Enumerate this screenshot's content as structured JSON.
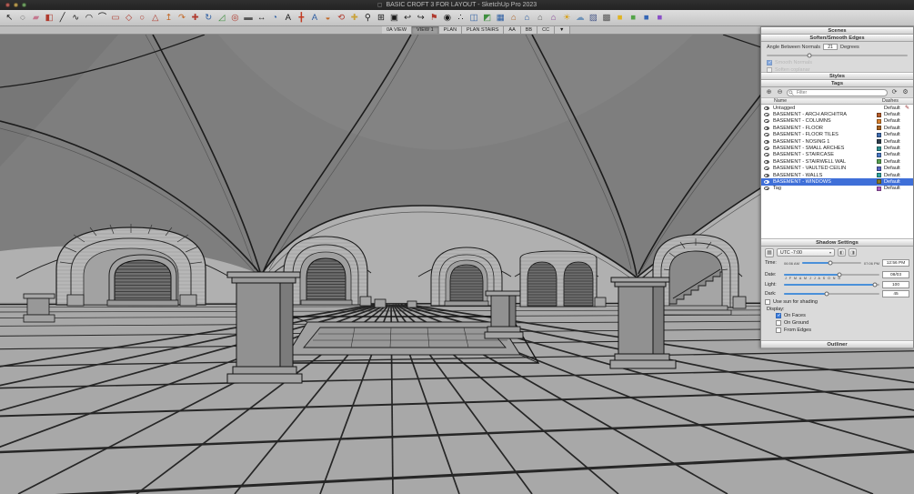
{
  "window": {
    "title": "BASIC CROFT 3 FOR LAYOUT - SketchUp Pro 2023"
  },
  "icons": {
    "add": "⊕",
    "remove": "⊖",
    "purge": "⟳",
    "gear": "⚙",
    "pencil": "✎",
    "dropdown_arrow": "▾",
    "document_proxy": "▢",
    "shadow_toggle": "▦",
    "detail_left": "◧",
    "detail_right": "◨"
  },
  "colors": {
    "selection": "#3f6fd8",
    "checkbox_accent": "#3d7fe0"
  },
  "toolbar": {
    "icons": [
      {
        "name": "select",
        "glyph": "↖",
        "color": "#1a1a1a"
      },
      {
        "name": "lasso",
        "glyph": "◌",
        "color": "#1a1a1a"
      },
      {
        "name": "eraser",
        "glyph": "▰",
        "color": "#c4788f"
      },
      {
        "name": "paint-bucket",
        "glyph": "◧",
        "color": "#b03a2e"
      },
      {
        "name": "line",
        "glyph": "╱",
        "color": "#1a1a1a"
      },
      {
        "name": "freehand",
        "glyph": "∿",
        "color": "#1a1a1a"
      },
      {
        "name": "arc",
        "glyph": "◠",
        "color": "#1a1a1a"
      },
      {
        "name": "two-point-arc",
        "glyph": "⌒",
        "color": "#1a1a1a"
      },
      {
        "name": "rectangle",
        "glyph": "▭",
        "color": "#b03a2e"
      },
      {
        "name": "rotated-rectangle",
        "glyph": "◇",
        "color": "#b03a2e"
      },
      {
        "name": "circle",
        "glyph": "○",
        "color": "#b03a2e"
      },
      {
        "name": "polygon",
        "glyph": "△",
        "color": "#b03a2e"
      },
      {
        "name": "push-pull",
        "glyph": "↥",
        "color": "#c26a2a"
      },
      {
        "name": "follow-me",
        "glyph": "↷",
        "color": "#c26a2a"
      },
      {
        "name": "move",
        "glyph": "✚",
        "color": "#b03a2e"
      },
      {
        "name": "rotate",
        "glyph": "↻",
        "color": "#2e5fa3"
      },
      {
        "name": "scale",
        "glyph": "◿",
        "color": "#3f8f3f"
      },
      {
        "name": "offset",
        "glyph": "◎",
        "color": "#b03a2e"
      },
      {
        "name": "tape-measure",
        "glyph": "▬",
        "color": "#555555"
      },
      {
        "name": "dimension",
        "glyph": "↔",
        "color": "#1a1a1a"
      },
      {
        "name": "protractor",
        "glyph": "◔",
        "color": "#2e5fa3"
      },
      {
        "name": "text",
        "glyph": "A",
        "color": "#1a1a1a"
      },
      {
        "name": "axes",
        "glyph": "╋",
        "color": "#c23b22"
      },
      {
        "name": "threed-text",
        "glyph": "A",
        "color": "#2e5fa3"
      },
      {
        "name": "section-plane",
        "glyph": "◒",
        "color": "#c26a2a"
      },
      {
        "name": "orbit",
        "glyph": "⟲",
        "color": "#b03a2e"
      },
      {
        "name": "pan",
        "glyph": "✚",
        "color": "#c9a23a"
      },
      {
        "name": "zoom",
        "glyph": "⚲",
        "color": "#1a1a1a"
      },
      {
        "name": "zoom-window",
        "glyph": "⊞",
        "color": "#1a1a1a"
      },
      {
        "name": "zoom-extents",
        "glyph": "▣",
        "color": "#1a1a1a"
      },
      {
        "name": "previous-view",
        "glyph": "↩",
        "color": "#1a1a1a"
      },
      {
        "name": "next-view",
        "glyph": "↪",
        "color": "#1a1a1a"
      },
      {
        "name": "position-camera",
        "glyph": "⚑",
        "color": "#b03a2e"
      },
      {
        "name": "look-around",
        "glyph": "◉",
        "color": "#1a1a1a"
      },
      {
        "name": "walk",
        "glyph": "∴",
        "color": "#1a1a1a"
      },
      {
        "name": "make-component",
        "glyph": "◫",
        "color": "#2e5fa3"
      },
      {
        "name": "view-iso",
        "glyph": "◩",
        "color": "#3f8f3f"
      },
      {
        "name": "view-top",
        "glyph": "▦",
        "color": "#2e5fa3"
      },
      {
        "name": "view-front",
        "glyph": "⌂",
        "color": "#b06a30"
      },
      {
        "name": "view-right",
        "glyph": "⌂",
        "color": "#2e5fa3"
      },
      {
        "name": "view-back",
        "glyph": "⌂",
        "color": "#6a6a6a"
      },
      {
        "name": "view-left",
        "glyph": "⌂",
        "color": "#8a4a9a"
      },
      {
        "name": "shadows",
        "glyph": "☀",
        "color": "#d8a017"
      },
      {
        "name": "fog",
        "glyph": "☁",
        "color": "#6f93b8"
      },
      {
        "name": "x-ray",
        "glyph": "▨",
        "color": "#4a5a8a"
      },
      {
        "name": "wireframe",
        "glyph": "▩",
        "color": "#555555"
      },
      {
        "name": "style-1",
        "glyph": "■",
        "color": "#e0b420"
      },
      {
        "name": "style-2",
        "glyph": "■",
        "color": "#52a447"
      },
      {
        "name": "style-3",
        "glyph": "■",
        "color": "#3566b5"
      },
      {
        "name": "style-4",
        "glyph": "■",
        "color": "#8a4fc8"
      }
    ]
  },
  "scene_tabs": [
    {
      "label": "0A VIEW",
      "active": false
    },
    {
      "label": "VIEW 1",
      "active": true
    },
    {
      "label": "PLAN",
      "active": false
    },
    {
      "label": "PLAN STAIRS",
      "active": false
    },
    {
      "label": "AA",
      "active": false
    },
    {
      "label": "BB",
      "active": false
    },
    {
      "label": "CC",
      "active": false
    },
    {
      "label": "▼",
      "active": false
    }
  ],
  "panel": {
    "scenes_title": "Scenes",
    "soften": {
      "title": "Soften/Smooth Edges",
      "angle_label": "Angle Between Normals",
      "angle_value": "21",
      "angle_unit": "Degrees",
      "smooth_normals": "Smooth Normals",
      "soften_coplanar": "Soften coplanar"
    },
    "styles_title": "Styles",
    "tags": {
      "title": "Tags",
      "filter_placeholder": "Filter",
      "col_name": "Name",
      "col_dashes": "Dashes",
      "rows": [
        {
          "name": "Untagged",
          "dashes": "Default",
          "color": "",
          "selected": false,
          "current": true
        },
        {
          "name": "BASEMENT - ARCH ARCHITRA",
          "dashes": "Default",
          "color": "#b65c2a",
          "selected": false,
          "current": false
        },
        {
          "name": "BASEMENT - COLUMNS",
          "dashes": "Default",
          "color": "#d77f2e",
          "selected": false,
          "current": false
        },
        {
          "name": "BASEMENT - FLOOR",
          "dashes": "Default",
          "color": "#a9611f",
          "selected": false,
          "current": false
        },
        {
          "name": "BASEMENT - FLOOR TILES",
          "dashes": "Default",
          "color": "#3f6db0",
          "selected": false,
          "current": false
        },
        {
          "name": "BASEMENT - NOSING 1",
          "dashes": "Default",
          "color": "#2f3e4e",
          "selected": false,
          "current": false
        },
        {
          "name": "BASEMENT - SMALL ARCHES",
          "dashes": "Default",
          "color": "#2f8f8f",
          "selected": false,
          "current": false
        },
        {
          "name": "BASEMENT - STAIRCASE",
          "dashes": "Default",
          "color": "#4a78c4",
          "selected": false,
          "current": false
        },
        {
          "name": "BASEMENT - STAIRWELL WAL",
          "dashes": "Default",
          "color": "#57a052",
          "selected": false,
          "current": false
        },
        {
          "name": "BASEMENT - VAULTED CEILIN",
          "dashes": "Default",
          "color": "#5566c0",
          "selected": false,
          "current": false
        },
        {
          "name": "BASEMENT - WALLS",
          "dashes": "Default",
          "color": "#2fa3a0",
          "selected": false,
          "current": false
        },
        {
          "name": "BASEMENT - WINDOWS",
          "dashes": "Default",
          "color": "#8c7a22",
          "selected": true,
          "current": false
        },
        {
          "name": "Tag",
          "dashes": "Default",
          "color": "#b05ec4",
          "selected": false,
          "current": false
        }
      ]
    },
    "shadows": {
      "title": "Shadow Settings",
      "tz": "UTC -7:00",
      "time_label": "Time:",
      "time_start": "06:56 AM",
      "time_end": "07:06 PM",
      "time_value": "12:56 PM",
      "date_label": "Date:",
      "date_ticks": "J F M A M J J A S O N D",
      "date_value": "08/03",
      "light_label": "Light:",
      "light_value": "100",
      "dark_label": "Dark:",
      "dark_value": "45",
      "use_sun": "Use sun for shading",
      "display_label": "Display:",
      "on_faces": "On Faces",
      "on_ground": "On Ground",
      "from_edges": "From Edges"
    },
    "outliner_title": "Outliner"
  }
}
